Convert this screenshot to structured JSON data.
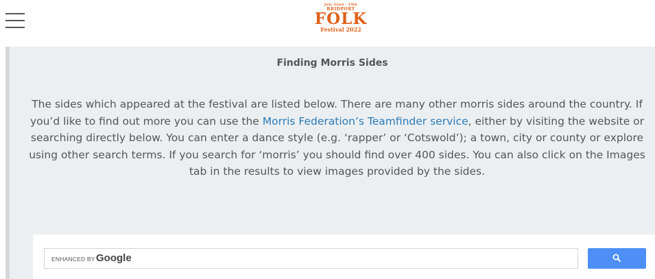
{
  "header": {
    "menu_icon": "hamburger-menu-icon",
    "logo": {
      "dates": "July 22nd - 24th",
      "town": "BRIDPORT",
      "name": "FOLK",
      "subtitle": "Festival 2022"
    }
  },
  "main": {
    "title": "Finding Morris Sides",
    "para_before": "The sides which appeared at the festival are listed below. There are many other morris sides around the country. If you’d like to find out more you can use the ",
    "link_text": "Morris Federation’s Teamfinder service",
    "para_after": ", either by visiting the website or searching directly below. You can enter a dance style (e.g. ‘rapper’ or ‘Cotswold’); a town, city or county or explore using other search terms. If you search for ‘morris’ you should find over 400 sides. You can also click on the Images tab in the results to view images provided by the sides."
  },
  "search": {
    "enhanced_by": "ENHANCED BY",
    "brand": "Google",
    "button_icon": "search-icon",
    "colors": {
      "button": "#4d8ff6",
      "link": "#2a7bb8"
    }
  }
}
